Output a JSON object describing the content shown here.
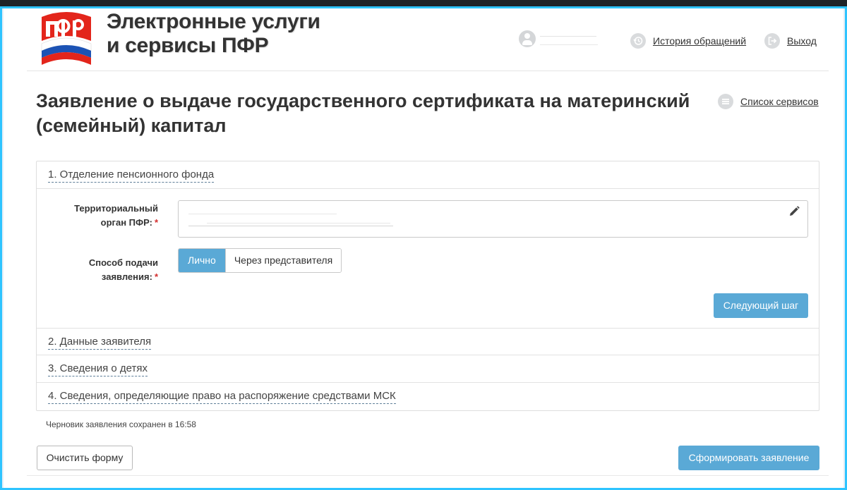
{
  "header": {
    "brand_line1": "Электронные услуги",
    "brand_line2": "и сервисы ПФР",
    "history_label": "История обращений",
    "logout_label": "Выход",
    "history_icon": "history-icon",
    "logout_icon": "logout-icon",
    "user_icon": "user-avatar-icon"
  },
  "page": {
    "title": "Заявление о выдаче государственного сертификата на материнский (семейный) капитал",
    "services_label": "Список сервисов",
    "services_icon": "list-icon"
  },
  "sections": [
    {
      "label": "1. Отделение пенсионного фонда",
      "expanded": true
    },
    {
      "label": "2. Данные заявителя",
      "expanded": false
    },
    {
      "label": "3. Сведения о детях",
      "expanded": false
    },
    {
      "label": "4. Сведения, определяющие право на распоряжение средствами МСК",
      "expanded": false
    }
  ],
  "form": {
    "organ_label_line1": "Территориальный",
    "organ_label_line2": "орган ПФР:",
    "method_label_line1": "Способ подачи",
    "method_label_line2": "заявления:",
    "required_mark": "*",
    "method_options": [
      "Лично",
      "Через представителя"
    ],
    "method_selected": "Лично",
    "next_button": "Следующий шаг",
    "edit_icon": "pencil-icon"
  },
  "draft_status": "Черновик заявления сохранен в 16:58",
  "actions": {
    "clear_label": "Очистить форму",
    "submit_label": "Сформировать заявление"
  },
  "colors": {
    "accent": "#5aa9d6",
    "text": "#333333",
    "required": "#d32f2f",
    "frame": "#2ec4ff"
  }
}
